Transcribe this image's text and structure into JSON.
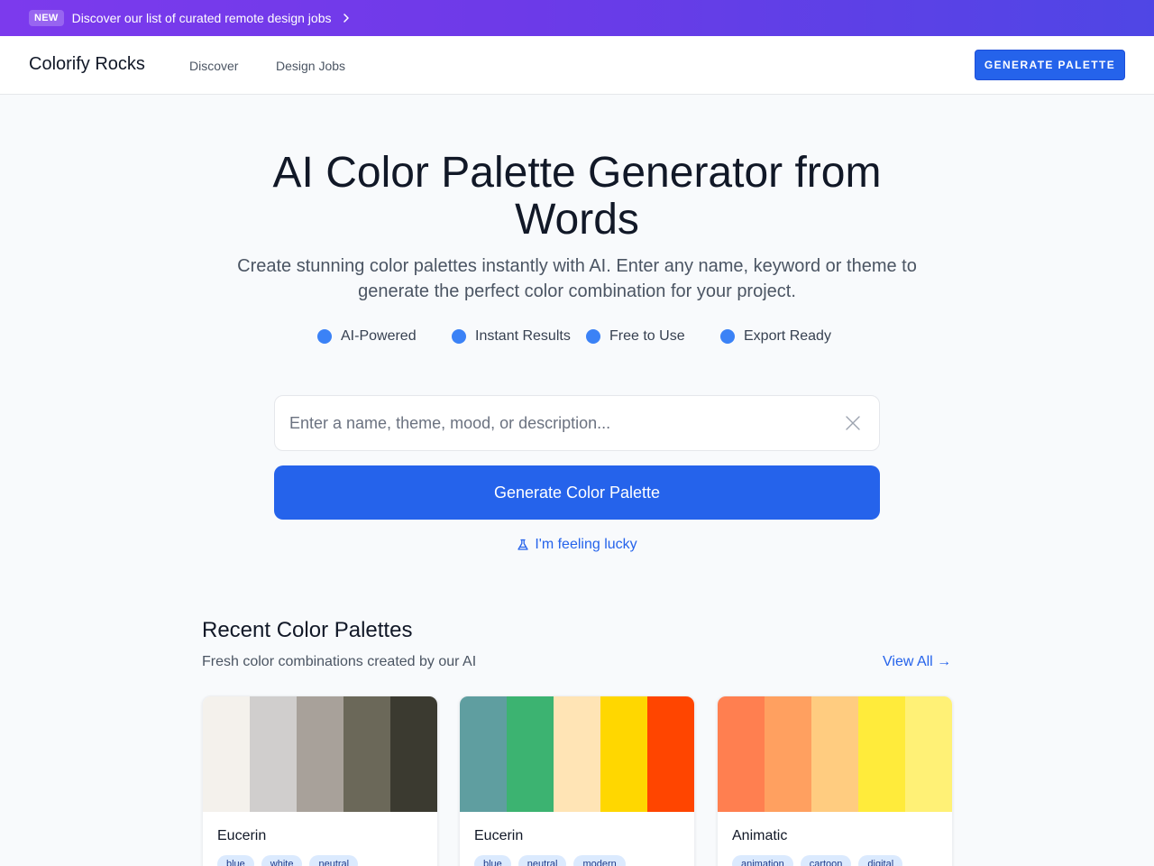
{
  "announcement": {
    "badge": "NEW",
    "text": "Discover our list of curated remote design jobs"
  },
  "nav": {
    "brand": "Colorify Rocks",
    "links": [
      "Discover",
      "Design Jobs"
    ],
    "cta": "GENERATE PALETTE"
  },
  "hero": {
    "title": "AI Color Palette Generator from Words",
    "subtitle": "Create stunning color palettes instantly with AI. Enter any name, keyword or theme to generate the perfect color combination for your project.",
    "features": [
      "AI-Powered",
      "Instant Results",
      "Free to Use",
      "Export Ready"
    ]
  },
  "search": {
    "placeholder": "Enter a name, theme, mood, or description...",
    "value": ""
  },
  "generate_button": "Generate Color Palette",
  "lucky_link": "I'm feeling lucky",
  "recent": {
    "title": "Recent Color Palettes",
    "subtitle": "Fresh color combinations created by our AI",
    "view_all": "View All →",
    "palettes": [
      {
        "name": "Eucerin",
        "colors": [
          "#f4f1ec",
          "#d0cecd",
          "#a8a19a",
          "#6b6859",
          "#3b3a30"
        ],
        "tags": [
          "blue",
          "white",
          "neutral"
        ]
      },
      {
        "name": "Eucerin",
        "colors": [
          "#5f9ea0",
          "#3cb371",
          "#ffe4b5",
          "#ffd700",
          "#ff4500"
        ],
        "tags": [
          "blue",
          "neutral",
          "modern"
        ]
      },
      {
        "name": "Animatic",
        "colors": [
          "#ff7f50",
          "#ffa060",
          "#ffcc80",
          "#ffeb3b",
          "#fff176"
        ],
        "tags": [
          "animation",
          "cartoon",
          "digital"
        ]
      }
    ]
  },
  "colors": {
    "primary": "#2563eb",
    "feature_dot": "#3b82f6",
    "banner_start": "#7c3aed",
    "banner_end": "#4f46e5"
  }
}
